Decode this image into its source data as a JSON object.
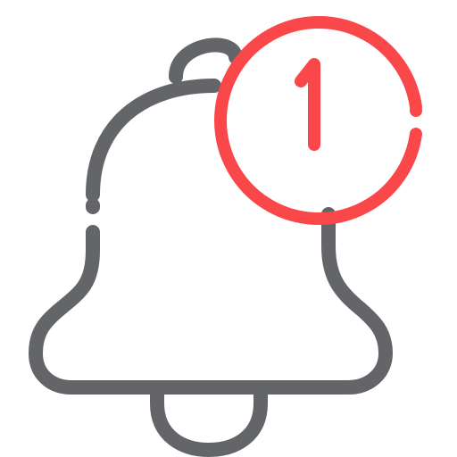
{
  "icon": {
    "name": "notification-bell-icon",
    "badge_name": "notification-count-badge-icon",
    "bell_color": "#646569",
    "badge_color": "#f9474a"
  },
  "badge": {
    "count": "1"
  }
}
